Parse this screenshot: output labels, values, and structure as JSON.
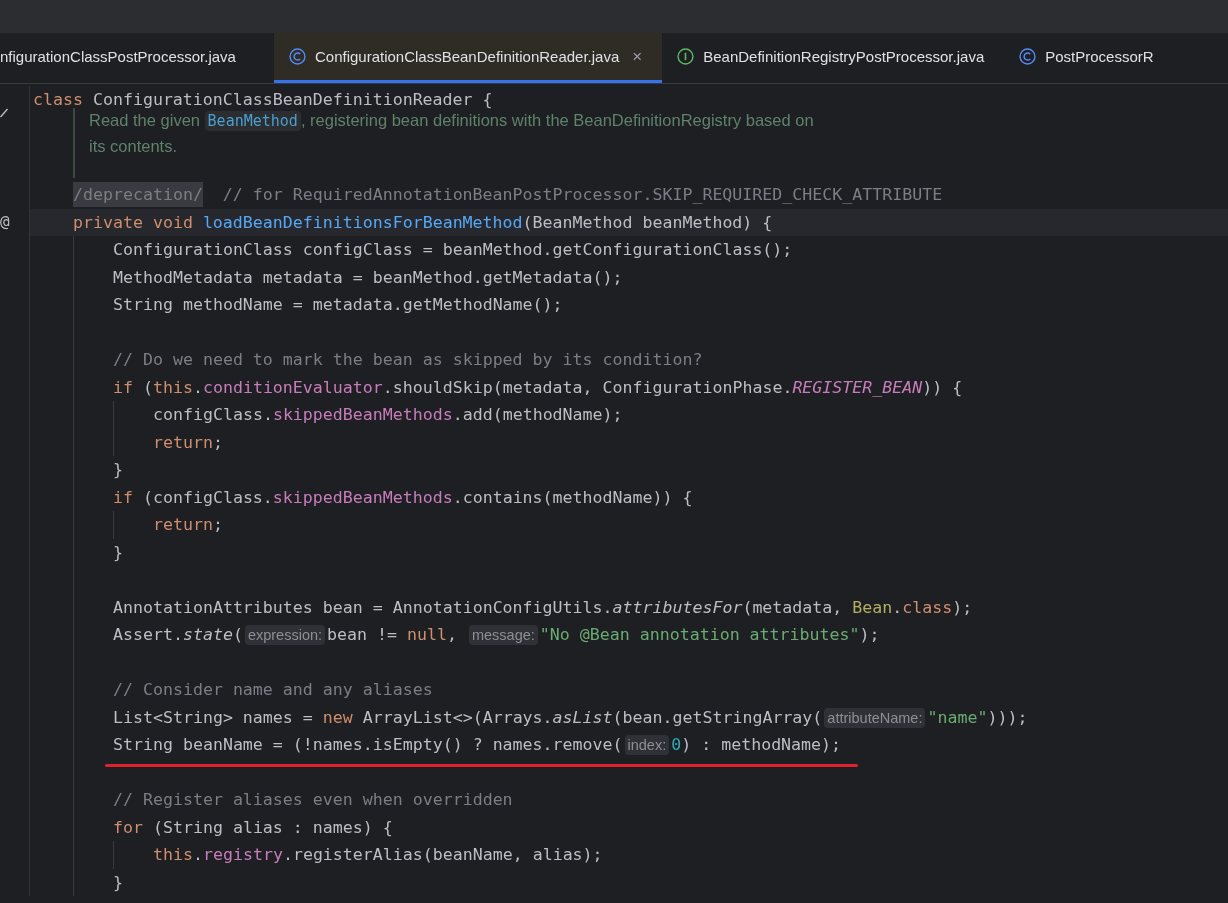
{
  "tabs": [
    {
      "label": "nfigurationClassPostProcessor.java",
      "kind": "plain",
      "selected": false
    },
    {
      "label": "ConfigurationClassBeanDefinitionReader.java",
      "kind": "class",
      "selected": true,
      "close": "×"
    },
    {
      "label": "BeanDefinitionRegistryPostProcessor.java",
      "kind": "interface",
      "selected": false
    },
    {
      "label": "PostProcessorR",
      "kind": "class",
      "selected": false
    }
  ],
  "lines": [
    {
      "kind": "code",
      "tokens": [
        {
          "kind": "kw",
          "text": "class"
        },
        {
          "kind": "plain",
          "text": " ConfigurationClassBeanDefinitionReader {"
        }
      ],
      "children": [
        {
          "kind": "doc",
          "lines": [
            [
              {
                "kind": "text",
                "text": "Read the given "
              },
              {
                "kind": "code",
                "text": "BeanMethod"
              },
              {
                "kind": "text",
                "text": ", registering bean definitions with the BeanDefinitionRegistry based on"
              }
            ],
            [
              {
                "kind": "text",
                "text": "its contents."
              }
            ]
          ]
        },
        {
          "kind": "code",
          "tokens": [
            {
              "kind": "dep",
              "text": "/deprecation/"
            },
            {
              "kind": "comment",
              "text": "  // for RequiredAnnotationBeanPostProcessor.SKIP_REQUIRED_CHECK_ATTRIBUTE"
            }
          ]
        },
        {
          "kind": "code",
          "current": true,
          "gutter": "@",
          "tokens": [
            {
              "kind": "kw",
              "text": "private void "
            },
            {
              "kind": "fn",
              "text": "loadBeanDefinitionsForBeanMethod"
            },
            {
              "kind": "plain",
              "text": "(BeanMethod beanMethod) {"
            }
          ],
          "children": [
            {
              "kind": "code",
              "tokens": [
                {
                  "kind": "plain",
                  "text": "ConfigurationClass configClass = beanMethod.getConfigurationClass();"
                }
              ]
            },
            {
              "kind": "code",
              "tokens": [
                {
                  "kind": "plain",
                  "text": "MethodMetadata metadata = beanMethod.getMetadata();"
                }
              ]
            },
            {
              "kind": "code",
              "tokens": [
                {
                  "kind": "plain",
                  "text": "String methodName = metadata.getMethodName();"
                }
              ]
            },
            {
              "kind": "blank"
            },
            {
              "kind": "code",
              "tokens": [
                {
                  "kind": "comment",
                  "text": "// Do we need to mark the bean as skipped by its condition?"
                }
              ]
            },
            {
              "kind": "code",
              "tokens": [
                {
                  "kind": "kw",
                  "text": "if"
                },
                {
                  "kind": "plain",
                  "text": " ("
                },
                {
                  "kind": "kw",
                  "text": "this"
                },
                {
                  "kind": "plain",
                  "text": "."
                },
                {
                  "kind": "field",
                  "text": "conditionEvaluator"
                },
                {
                  "kind": "plain",
                  "text": ".shouldSkip(metadata, ConfigurationPhase."
                },
                {
                  "kind": "const",
                  "text": "REGISTER_BEAN"
                },
                {
                  "kind": "plain",
                  "text": ")) {"
                }
              ],
              "children": [
                {
                  "kind": "code",
                  "tokens": [
                    {
                      "kind": "plain",
                      "text": "configClass."
                    },
                    {
                      "kind": "field",
                      "text": "skippedBeanMethods"
                    },
                    {
                      "kind": "plain",
                      "text": ".add(methodName);"
                    }
                  ]
                },
                {
                  "kind": "code",
                  "tokens": [
                    {
                      "kind": "kw",
                      "text": "return"
                    },
                    {
                      "kind": "plain",
                      "text": ";"
                    }
                  ]
                }
              ]
            },
            {
              "kind": "code",
              "tokens": [
                {
                  "kind": "plain",
                  "text": "}"
                }
              ]
            },
            {
              "kind": "code",
              "tokens": [
                {
                  "kind": "kw",
                  "text": "if"
                },
                {
                  "kind": "plain",
                  "text": " (configClass."
                },
                {
                  "kind": "field",
                  "text": "skippedBeanMethods"
                },
                {
                  "kind": "plain",
                  "text": ".contains(methodName)) {"
                }
              ],
              "children": [
                {
                  "kind": "code",
                  "tokens": [
                    {
                      "kind": "kw",
                      "text": "return"
                    },
                    {
                      "kind": "plain",
                      "text": ";"
                    }
                  ]
                }
              ]
            },
            {
              "kind": "code",
              "tokens": [
                {
                  "kind": "plain",
                  "text": "}"
                }
              ]
            },
            {
              "kind": "blank"
            },
            {
              "kind": "code",
              "tokens": [
                {
                  "kind": "plain",
                  "text": "AnnotationAttributes bean = AnnotationConfigUtils."
                },
                {
                  "kind": "italic",
                  "text": "attributesFor"
                },
                {
                  "kind": "plain",
                  "text": "(metadata, "
                },
                {
                  "kind": "annot",
                  "text": "Bean"
                },
                {
                  "kind": "plain",
                  "text": "."
                },
                {
                  "kind": "kw",
                  "text": "class"
                },
                {
                  "kind": "plain",
                  "text": ");"
                }
              ]
            },
            {
              "kind": "code",
              "tokens": [
                {
                  "kind": "plain",
                  "text": "Assert."
                },
                {
                  "kind": "italic",
                  "text": "state"
                },
                {
                  "kind": "plain",
                  "text": "("
                },
                {
                  "kind": "hint",
                  "text": "expression:"
                },
                {
                  "kind": "plain",
                  "text": "bean != "
                },
                {
                  "kind": "kw",
                  "text": "null"
                },
                {
                  "kind": "plain",
                  "text": ", "
                },
                {
                  "kind": "hint",
                  "text": "message:"
                },
                {
                  "kind": "str",
                  "text": "\"No @Bean annotation attributes\""
                },
                {
                  "kind": "plain",
                  "text": ");"
                }
              ]
            },
            {
              "kind": "blank"
            },
            {
              "kind": "code",
              "tokens": [
                {
                  "kind": "comment",
                  "text": "// Consider name and any aliases"
                }
              ]
            },
            {
              "kind": "code",
              "tokens": [
                {
                  "kind": "plain",
                  "text": "List<String> names = "
                },
                {
                  "kind": "kw",
                  "text": "new"
                },
                {
                  "kind": "plain",
                  "text": " ArrayList<>(Arrays."
                },
                {
                  "kind": "italic",
                  "text": "asList"
                },
                {
                  "kind": "plain",
                  "text": "(bean.getStringArray("
                },
                {
                  "kind": "hint",
                  "text": "attributeName:"
                },
                {
                  "kind": "str",
                  "text": "\"name\""
                },
                {
                  "kind": "plain",
                  "text": ")));"
                }
              ]
            },
            {
              "kind": "code",
              "underlined": true,
              "tokens": [
                {
                  "kind": "plain",
                  "text": "String beanName = (!names.isEmpty() ? names.remove("
                },
                {
                  "kind": "hint",
                  "text": "index:"
                },
                {
                  "kind": "num",
                  "text": "0"
                },
                {
                  "kind": "plain",
                  "text": ") : methodName);"
                }
              ]
            },
            {
              "kind": "blank"
            },
            {
              "kind": "code",
              "tokens": [
                {
                  "kind": "comment",
                  "text": "// Register aliases even when overridden"
                }
              ]
            },
            {
              "kind": "code",
              "tokens": [
                {
                  "kind": "kw",
                  "text": "for"
                },
                {
                  "kind": "plain",
                  "text": " (String alias : names) {"
                }
              ],
              "children": [
                {
                  "kind": "code",
                  "tokens": [
                    {
                      "kind": "kw",
                      "text": "this"
                    },
                    {
                      "kind": "plain",
                      "text": "."
                    },
                    {
                      "kind": "field",
                      "text": "registry"
                    },
                    {
                      "kind": "plain",
                      "text": ".registerAlias(beanName, alias);"
                    }
                  ]
                }
              ]
            },
            {
              "kind": "code",
              "tokens": [
                {
                  "kind": "plain",
                  "text": "}"
                }
              ]
            }
          ]
        }
      ]
    }
  ]
}
